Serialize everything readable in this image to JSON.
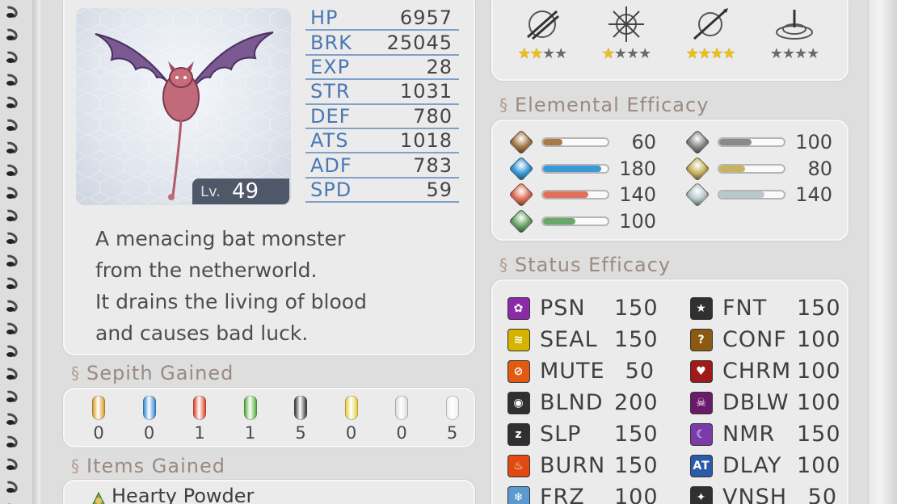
{
  "monster": {
    "level_label": "Lv.",
    "level": "49",
    "stats": [
      {
        "label": "HP",
        "value": "6957"
      },
      {
        "label": "BRK",
        "value": "25045"
      },
      {
        "label": "EXP",
        "value": "28"
      },
      {
        "label": "STR",
        "value": "1031"
      },
      {
        "label": "DEF",
        "value": "780"
      },
      {
        "label": "ATS",
        "value": "1018"
      },
      {
        "label": "ADF",
        "value": "783"
      },
      {
        "label": "SPD",
        "value": "59"
      }
    ],
    "description": [
      "A menacing bat monster",
      "from the netherworld.",
      "It drains the living of blood",
      "and causes bad luck."
    ]
  },
  "attack_efficacy": [
    {
      "icon": "slash-icon",
      "stars": 2,
      "max_stars": 4
    },
    {
      "icon": "thrust-icon",
      "stars": 1,
      "max_stars": 4
    },
    {
      "icon": "pierce-icon",
      "stars": 4,
      "max_stars": 4
    },
    {
      "icon": "strike-icon",
      "stars": 0,
      "max_stars": 4
    }
  ],
  "elemental": {
    "title": "Elemental Efficacy",
    "items": [
      {
        "element": "earth",
        "color": "#a87a4a",
        "value": "60",
        "fill": 0.3
      },
      {
        "element": "water",
        "color": "#3a9ad8",
        "value": "180",
        "fill": 0.9
      },
      {
        "element": "fire",
        "color": "#e0705a",
        "value": "140",
        "fill": 0.7
      },
      {
        "element": "wind",
        "color": "#6aa86a",
        "value": "100",
        "fill": 0.5
      },
      {
        "element": "time",
        "color": "#8a8a8a",
        "value": "100",
        "fill": 0.5
      },
      {
        "element": "space",
        "color": "#c8b260",
        "value": "80",
        "fill": 0.4
      },
      {
        "element": "mirage",
        "color": "#b8c8cc",
        "value": "140",
        "fill": 0.7
      }
    ]
  },
  "status": {
    "title": "Status Efficacy",
    "items": [
      {
        "name": "PSN",
        "value": "150",
        "icon": "poison-icon",
        "color": "#8a2aa8"
      },
      {
        "name": "SEAL",
        "value": "150",
        "icon": "seal-icon",
        "color": "#d4b400"
      },
      {
        "name": "MUTE",
        "value": "50",
        "icon": "mute-icon",
        "color": "#e05a10"
      },
      {
        "name": "BLND",
        "value": "200",
        "icon": "blind-icon",
        "color": "#303030"
      },
      {
        "name": "SLP",
        "value": "150",
        "icon": "sleep-icon",
        "color": "#303030"
      },
      {
        "name": "BURN",
        "value": "150",
        "icon": "burn-icon",
        "color": "#e04a10"
      },
      {
        "name": "FRZ",
        "value": "100",
        "icon": "freeze-icon",
        "color": "#5a9ad0"
      },
      {
        "name": "FNT",
        "value": "150",
        "icon": "faint-icon",
        "color": "#303030"
      },
      {
        "name": "CONF",
        "value": "100",
        "icon": "confuse-icon",
        "color": "#8a5a10"
      },
      {
        "name": "CHRM",
        "value": "100",
        "icon": "charm-icon",
        "color": "#a01a1a"
      },
      {
        "name": "DBLW",
        "value": "100",
        "icon": "deathblow-icon",
        "color": "#6a1a6a"
      },
      {
        "name": "NMR",
        "value": "150",
        "icon": "nightmare-icon",
        "color": "#7a3aa8"
      },
      {
        "name": "DLAY",
        "value": "100",
        "icon": "delay-icon",
        "color": "#2a5aa8"
      },
      {
        "name": "VNSH",
        "value": "50",
        "icon": "vanish-icon",
        "color": "#303030"
      }
    ]
  },
  "sepith": {
    "title": "Sepith Gained",
    "items": [
      {
        "type": "earth",
        "color": "#d9a030",
        "count": "0"
      },
      {
        "type": "water",
        "color": "#3a8ed8",
        "count": "0"
      },
      {
        "type": "fire",
        "color": "#e04a30",
        "count": "1"
      },
      {
        "type": "wind",
        "color": "#5ab040",
        "count": "1"
      },
      {
        "type": "time",
        "color": "#404040",
        "count": "5"
      },
      {
        "type": "space",
        "color": "#e8d040",
        "count": "0"
      },
      {
        "type": "mirage",
        "color": "#d8dde0",
        "count": "0"
      },
      {
        "type": "mass",
        "color": "#f0f0f0",
        "count": "5"
      }
    ]
  },
  "items_gained": {
    "title": "Items Gained",
    "items": [
      {
        "name": "Hearty Powder",
        "icon": "powder-icon"
      }
    ]
  }
}
